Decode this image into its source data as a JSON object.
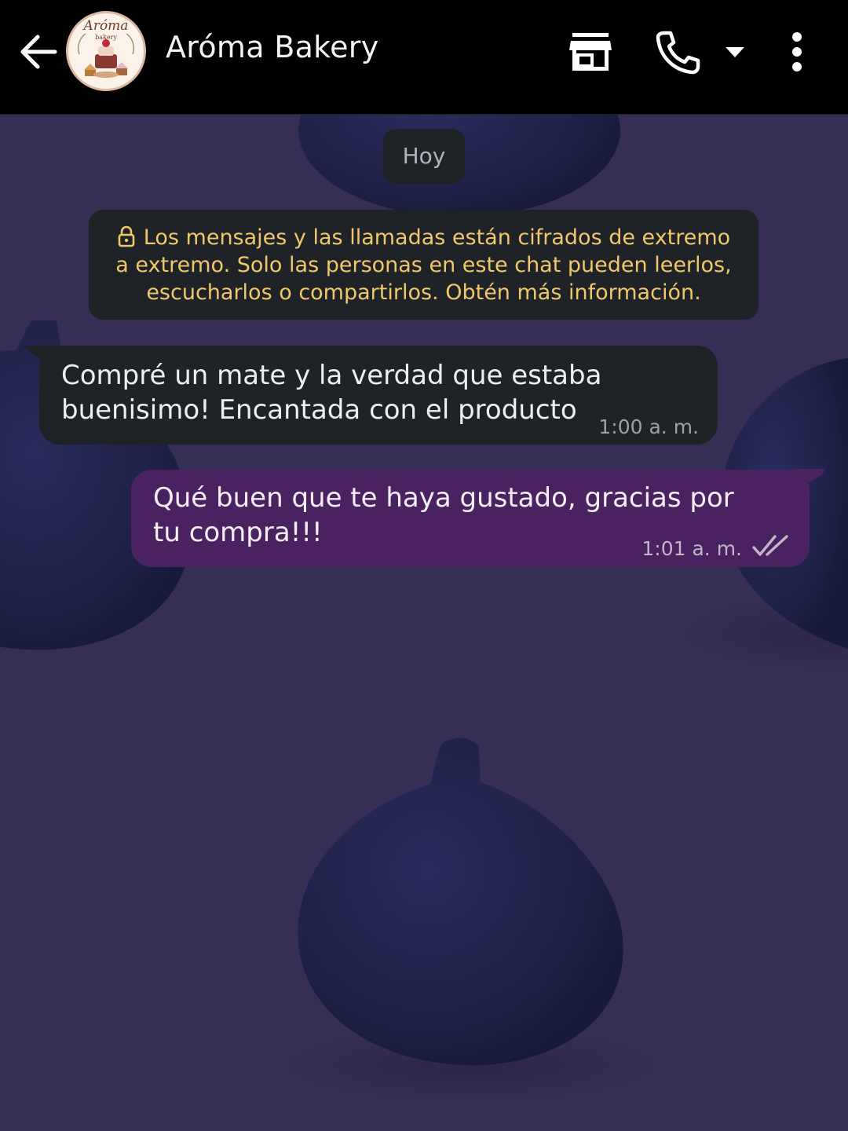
{
  "header": {
    "contact_name": "Aróma Bakery",
    "avatar_brand": "Aróma",
    "avatar_sub": "bakery",
    "icons": {
      "back": "arrow-back-icon",
      "store": "store-icon",
      "call": "phone-icon",
      "call_dropdown": "caret-down-icon",
      "menu": "more-vertical-icon"
    }
  },
  "chat": {
    "date_chip": "Hoy",
    "security_notice": "Los mensajes y las llamadas están cifrados de extremo a extremo. Solo las personas en este chat pueden leerlos, escucharlos o compartirlos. Obtén más información.",
    "messages": [
      {
        "direction": "incoming",
        "text": "Compré un mate y la verdad que estaba buenisimo! Encantada con el producto",
        "time": "1:00 a. m."
      },
      {
        "direction": "outgoing",
        "text": "Qué buen que te haya gustado, gracias por tu compra!!!",
        "time": "1:01 a. m.",
        "status": "read"
      }
    ]
  },
  "colors": {
    "topbar": "#000000",
    "wallpaper": "#362e54",
    "incoming_bubble": "#1f2328",
    "outgoing_bubble": "#4a2260",
    "security_text": "#f0c86a"
  }
}
